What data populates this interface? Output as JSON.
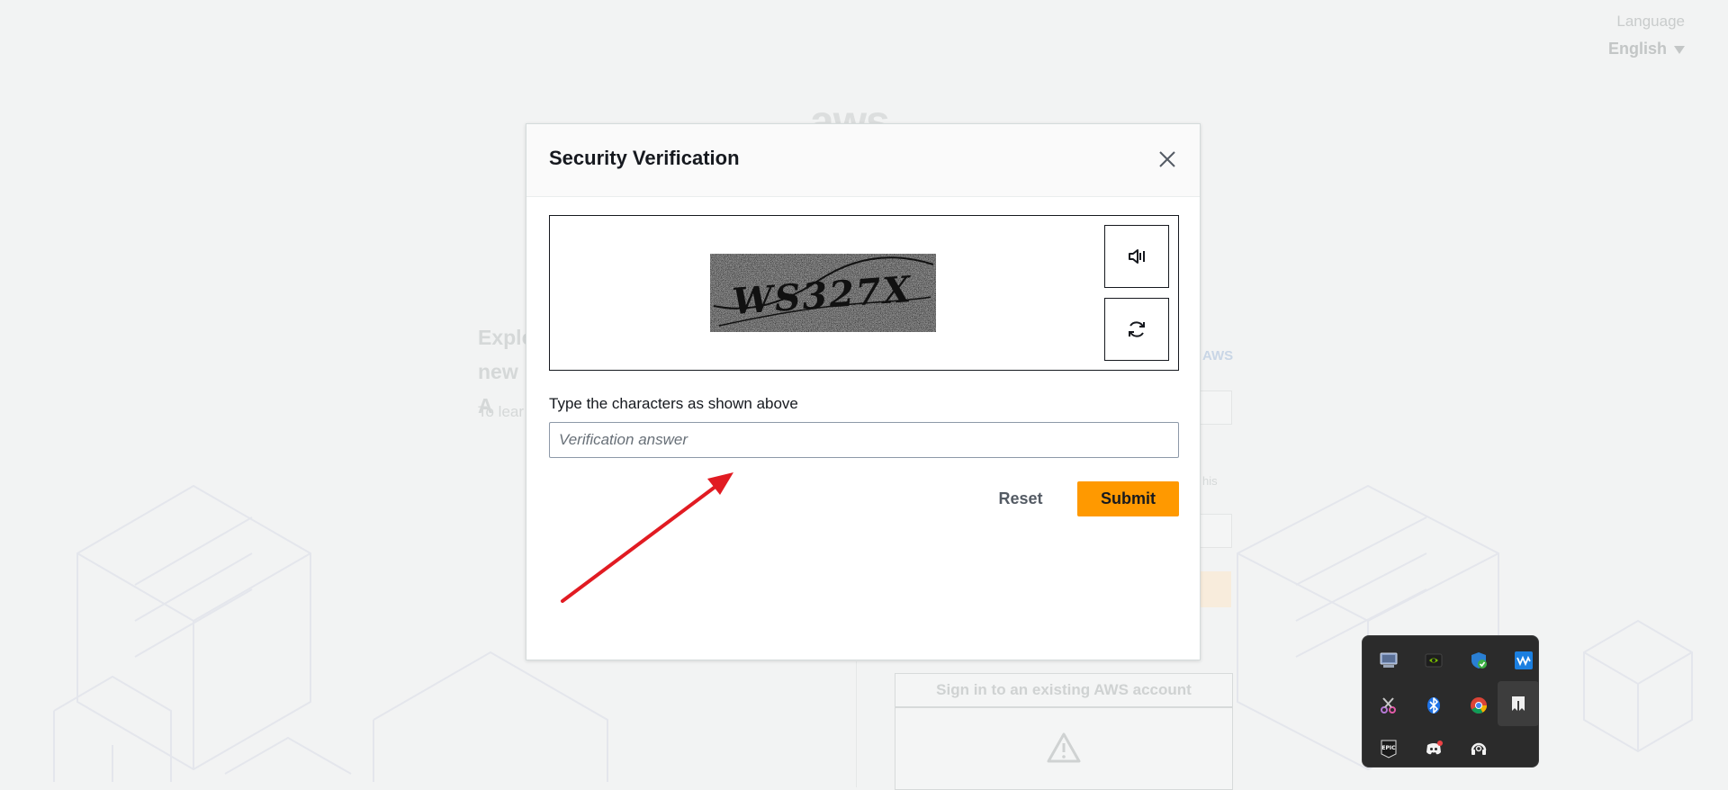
{
  "background_page": {
    "language_label": "Language",
    "language_value": "English",
    "logo_text": "aws",
    "explore_line1": "Explo",
    "explore_line2": "new A",
    "to_learn": "To lear",
    "aws_link": "AWS",
    "fragment_this": "his",
    "signin_existing": "Sign in to an existing AWS account"
  },
  "modal": {
    "title": "Security Verification",
    "captcha_text": "WS327X",
    "field_label": "Type the characters as shown above",
    "answer_placeholder": "Verification answer",
    "answer_value": "",
    "reset_label": "Reset",
    "submit_label": "Submit",
    "accent_color": "#ff9900"
  },
  "tray": {
    "icons": [
      "display-icon",
      "nvidia-icon",
      "security-shield-icon",
      "audio-meter-icon",
      "snipping-tool-icon",
      "bluetooth-icon",
      "chrome-icon",
      "bookmark-app-icon",
      "epic-games-icon",
      "discord-icon",
      "headset-icon"
    ]
  }
}
